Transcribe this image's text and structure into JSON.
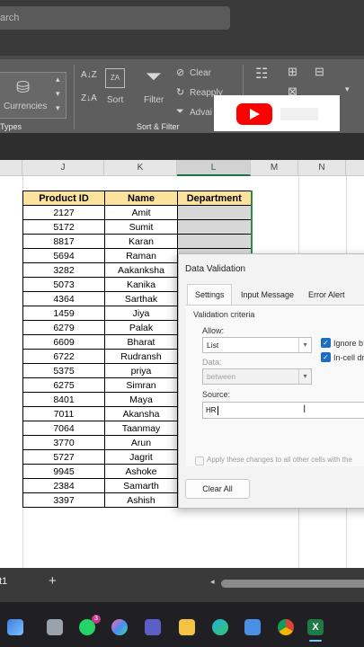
{
  "titlebar": {
    "search_text": "arch"
  },
  "ribbon": {
    "currencies_label": "Currencies",
    "group_types_label": "Types",
    "sort_label": "Sort",
    "filter_label": "Filter",
    "clear_label": "Clear",
    "reapply_label": "Reapply",
    "advanced_label": "Advai",
    "group_sort_filter_label": "Sort & Filter",
    "sort_az_glyph": "A↓Z",
    "sort_za_glyph": "Z↓A",
    "sort_box_glyph": "ZA"
  },
  "columns": [
    {
      "letter": "J",
      "selected": false
    },
    {
      "letter": "K",
      "selected": false
    },
    {
      "letter": "L",
      "selected": true
    },
    {
      "letter": "M",
      "selected": false
    },
    {
      "letter": "N",
      "selected": false
    }
  ],
  "table": {
    "headers": [
      "Product ID",
      "Name",
      "Department"
    ],
    "rows": [
      [
        "2127",
        "Amit"
      ],
      [
        "5172",
        "Sumit"
      ],
      [
        "8817",
        "Karan"
      ],
      [
        "5694",
        "Raman"
      ],
      [
        "3282",
        "Aakanksha"
      ],
      [
        "5073",
        "Kanika"
      ],
      [
        "4364",
        "Sarthak"
      ],
      [
        "1459",
        "Jiya"
      ],
      [
        "6279",
        "Palak"
      ],
      [
        "6609",
        "Bharat"
      ],
      [
        "6722",
        "Rudransh"
      ],
      [
        "5375",
        "priya"
      ],
      [
        "6275",
        "Simran"
      ],
      [
        "8401",
        "Maya"
      ],
      [
        "7011",
        "Akansha"
      ],
      [
        "7064",
        "Taanmay"
      ],
      [
        "3770",
        "Arun"
      ],
      [
        "5727",
        "Jagrit"
      ],
      [
        "9945",
        "Ashoke"
      ],
      [
        "2384",
        "Samarth"
      ],
      [
        "3397",
        "Ashish"
      ]
    ]
  },
  "dialog": {
    "title": "Data Validation",
    "tabs": [
      "Settings",
      "Input Message",
      "Error Alert"
    ],
    "active_tab": "Settings",
    "criteria_label": "Validation criteria",
    "allow_label": "Allow:",
    "allow_value": "List",
    "data_label": "Data:",
    "data_value": "between",
    "source_label": "Source:",
    "source_value": "HR",
    "ignore_blank_label": "Ignore b",
    "in_cell_label": "In-cell dr",
    "apply_all_label": "Apply these changes to all other cells with the",
    "clear_all_label": "Clear All"
  },
  "sheetbar": {
    "sheet_tab": "t1",
    "add_sheet": "+"
  },
  "taskbar": {
    "whatsapp_badge": "3"
  },
  "colors": {
    "accent_green": "#217346",
    "header_fill": "#fbe39e",
    "youtube_red": "#ff0000"
  }
}
